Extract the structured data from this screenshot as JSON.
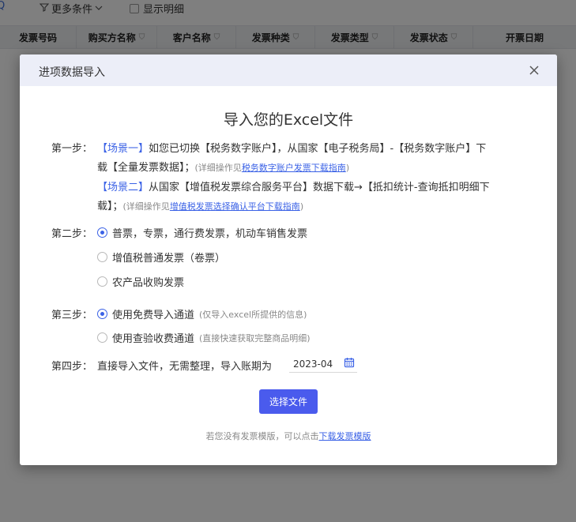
{
  "background": {
    "toolbar": {
      "more_filters": "更多条件",
      "show_detail": "显示明细"
    },
    "columns": [
      "发票号码",
      "购买方名称",
      "客户名称",
      "发票种类",
      "发票类型",
      "发票状态",
      "开票日期"
    ]
  },
  "dialog": {
    "title": "进项数据导入",
    "heading": "导入您的Excel文件",
    "step1": {
      "label": "第一步：",
      "scene1_tag": "【场景一】",
      "scene1_text_a": "如您已切换【税务数字账户】，从国家【电子税务局】-【税务数字账户】下",
      "scene1_text_b": "载【全量发票数据】；",
      "scene1_note": "(详细操作见",
      "scene1_link": "税务数字账户发票下载指南",
      "scene1_note_end": ")",
      "scene2_tag": "【场景二】",
      "scene2_text_a": "从国家【增值税发票综合服务平台】数据下载→【抵扣统计-查询抵扣明细下",
      "scene2_text_b": "载】；",
      "scene2_note": "(详细操作见",
      "scene2_link": "增值税发票选择确认平台下载指南",
      "scene2_note_end": ")"
    },
    "step2": {
      "label": "第二步：",
      "options": [
        "普票，专票，通行费发票，机动车销售发票",
        "增值税普通发票（卷票）",
        "农产品收购发票"
      ]
    },
    "step3": {
      "label": "第三步：",
      "option1": "使用免费导入通道",
      "option1_sub": "(仅导入excel所提供的信息)",
      "option2": "使用查验收费通道",
      "option2_sub": "(直接快速获取完整商品明细)"
    },
    "step4": {
      "label": "第四步：",
      "text": "直接导入文件，无需整理，导入账期为",
      "period": "2023-04"
    },
    "select_file_button": "选择文件",
    "footer_text": "若您没有发票模版，可以点击",
    "footer_link": "下载发票模版"
  },
  "colors": {
    "accent": "#3b62e6",
    "button": "#4a5bed",
    "dialog_header": "#eceef8"
  }
}
